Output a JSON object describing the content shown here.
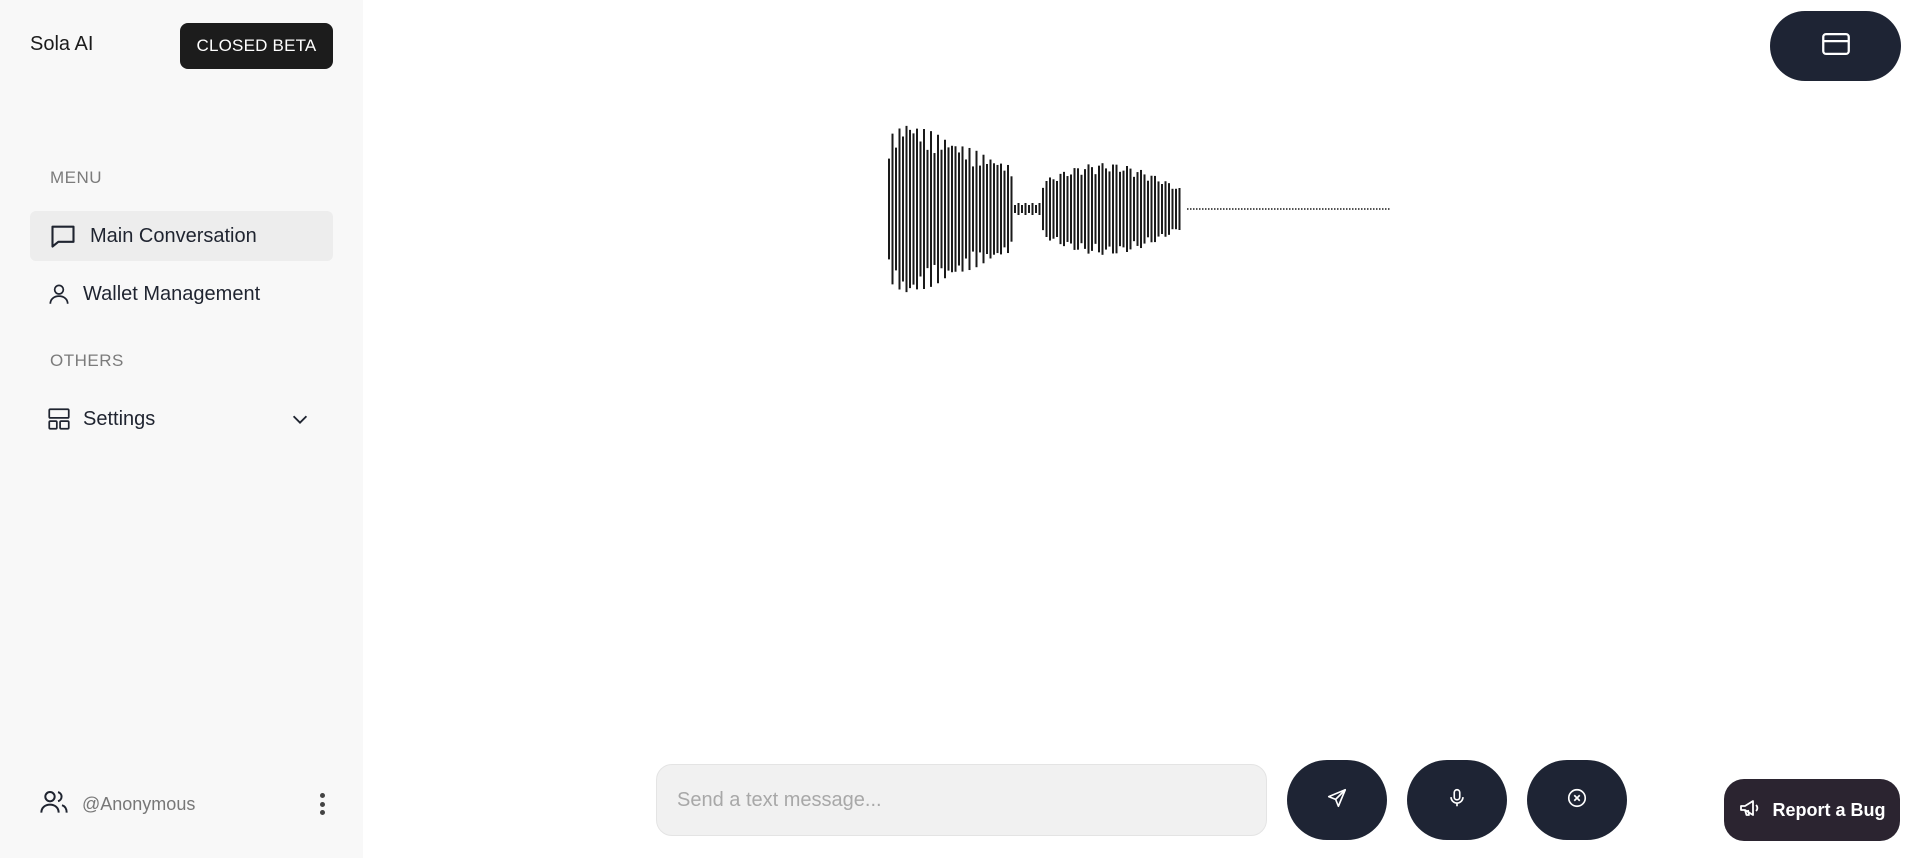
{
  "sidebar": {
    "brand": "Sola AI",
    "beta_badge": "CLOSED BETA",
    "menu_heading": "MENU",
    "items": [
      {
        "label": "Main Conversation",
        "icon": "chat-bubble-icon",
        "active": true
      },
      {
        "label": "Wallet Management",
        "icon": "user-icon",
        "active": false
      }
    ],
    "others_heading": "OTHERS",
    "settings_label": "Settings",
    "user_handle": "@Anonymous"
  },
  "header": {
    "card_button_icon": "credit-card-icon"
  },
  "composer": {
    "placeholder": "Send a text message...",
    "value": "",
    "send_icon": "send-icon",
    "mic_icon": "microphone-icon",
    "stop_icon": "close-circle-icon"
  },
  "report_bug": {
    "label": "Report a Bug",
    "icon": "megaphone-icon"
  },
  "colors": {
    "sidebar_bg": "#f8f8f8",
    "dark_button": "#1e2434",
    "bug_button": "#2b2430",
    "active_item_bg": "#ededed"
  }
}
